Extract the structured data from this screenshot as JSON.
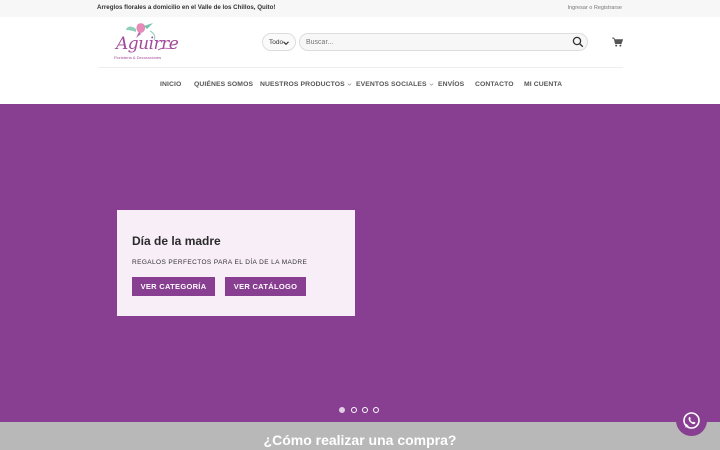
{
  "topbar": {
    "promo": "Arreglos florales a domicilio en el Valle de los Chillos, Quito!",
    "login": "Ingresar o Registrarse"
  },
  "logo": {
    "name": "Aguirre",
    "tagline": "Floristería & Decoraciones",
    "color": "#a34b9b"
  },
  "search": {
    "category_value": "Todo",
    "placeholder": "Buscar...",
    "icon": "search-icon"
  },
  "cart": {
    "icon": "shopping-cart-icon"
  },
  "nav": {
    "items": [
      {
        "label": "INICIO",
        "has_dropdown": false
      },
      {
        "label": "QUIÉNES SOMOS",
        "has_dropdown": false
      },
      {
        "label": "NUESTROS PRODUCTOS",
        "has_dropdown": true
      },
      {
        "label": "EVENTOS SOCIALES",
        "has_dropdown": true
      },
      {
        "label": "ENVÍOS",
        "has_dropdown": false
      },
      {
        "label": "CONTACTO",
        "has_dropdown": false
      },
      {
        "label": "MI CUENTA",
        "has_dropdown": false
      }
    ]
  },
  "hero": {
    "background": "#883f91",
    "title": "Día de la madre",
    "subtitle": "REGALOS PERFECTOS PARA EL DÍA DE LA MADRE",
    "button_category": "VER CATEGORÍA",
    "button_catalog": "VER CATÁLOGO",
    "slides": 4,
    "active_slide": 1
  },
  "how_to": {
    "title": "¿Cómo realizar una compra?"
  },
  "whatsapp": {
    "icon": "whatsapp-icon"
  },
  "colors": {
    "accent": "#883f91",
    "card": "#f8eef8",
    "section_gray": "#b8b8b8"
  }
}
